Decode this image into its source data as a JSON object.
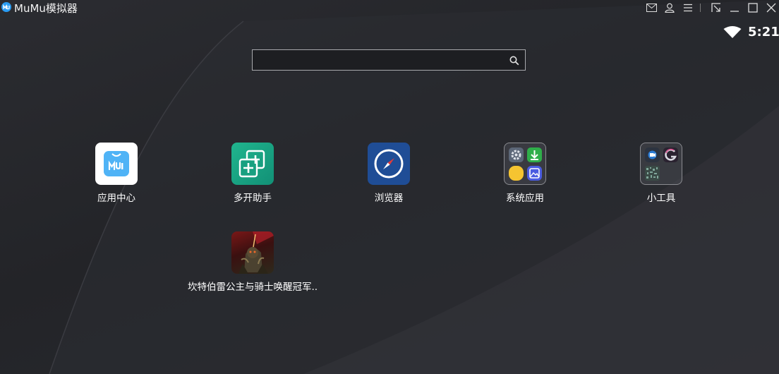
{
  "window": {
    "title": "MuMu模拟器"
  },
  "status": {
    "time": "5:21"
  },
  "search": {
    "value": "",
    "placeholder": ""
  },
  "apps": [
    {
      "label": "应用中心"
    },
    {
      "label": "多开助手"
    },
    {
      "label": "浏览器"
    },
    {
      "label": "系统应用"
    },
    {
      "label": "小工具"
    },
    {
      "label": "坎特伯雷公主与骑士唤醒冠军.."
    }
  ],
  "colors": {
    "accent": "#2a9df4",
    "multi_open": "#1aa583",
    "browser": "#1f4d96"
  }
}
